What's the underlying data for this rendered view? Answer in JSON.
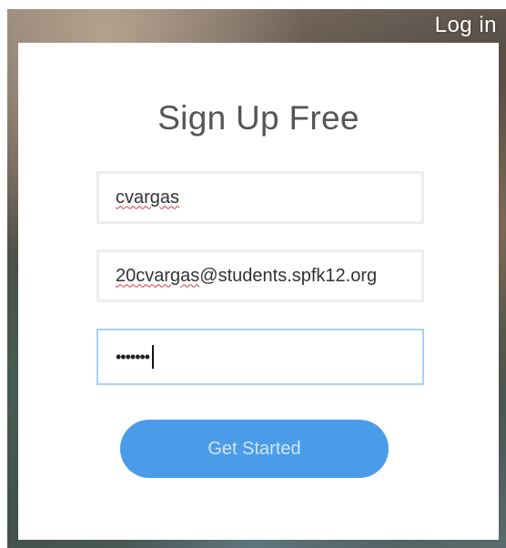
{
  "header": {
    "login_label": "Log in"
  },
  "signup": {
    "title": "Sign Up Free",
    "username_value": "cvargas",
    "email_value": "20cvargas@students.spfk12.org",
    "password_masked": "•••••••",
    "submit_label": "Get Started"
  },
  "colors": {
    "accent": "#4b9ce8",
    "focus_border": "#a6d0f4",
    "field_border": "#eeeeee",
    "title_text": "#555555"
  }
}
